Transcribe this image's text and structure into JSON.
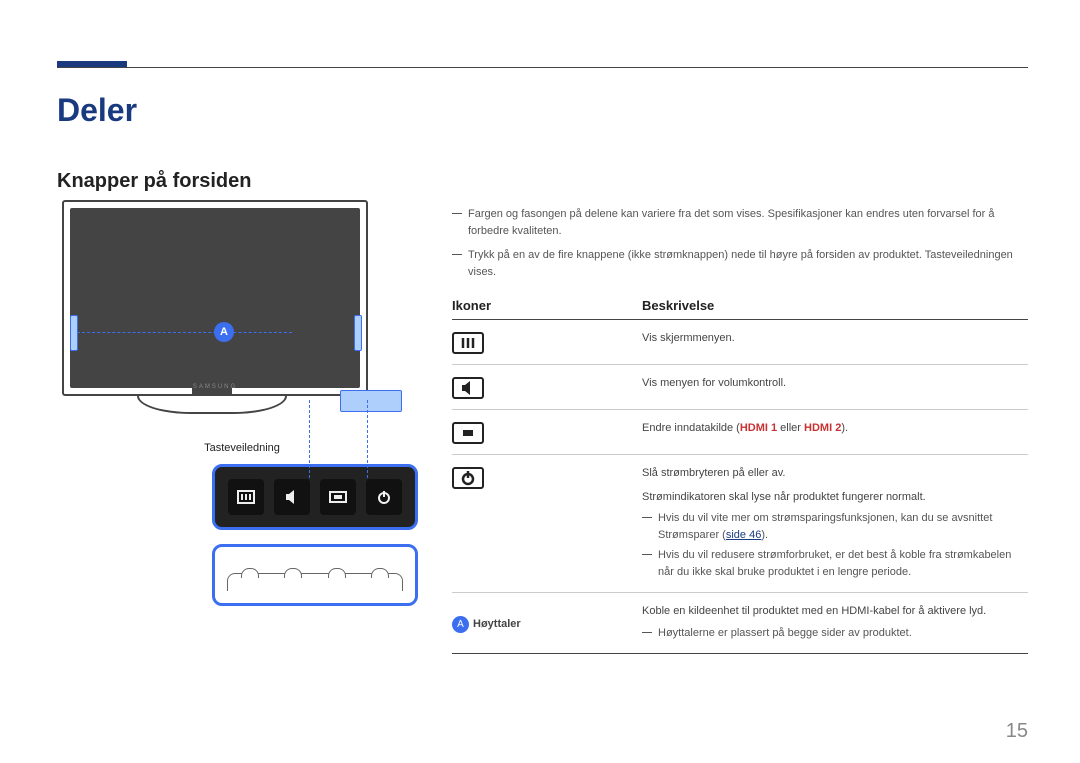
{
  "page_number": "15",
  "h1": "Deler",
  "h2": "Knapper på forsiden",
  "guide_label": "Tasteveiledning",
  "brand": "SAMSUNG",
  "marker_a": "A",
  "notes": {
    "n1": "Fargen og fasongen på delene kan variere fra det som vises. Spesifikasjoner kan endres uten forvarsel for å forbedre kvaliteten.",
    "n2": "Trykk på en av de fire knappene (ikke strømknappen) nede til høyre på forsiden av produktet. Tasteveiledningen vises."
  },
  "table": {
    "head_icon": "Ikoner",
    "head_desc": "Beskrivelse",
    "rows": [
      {
        "icon": "menu",
        "desc": "Vis skjermmenyen."
      },
      {
        "icon": "volume",
        "desc": "Vis menyen for volumkontroll."
      },
      {
        "icon": "source",
        "desc_pre": "Endre inndatakilde (",
        "hdmi1": "HDMI 1",
        "mid": " eller ",
        "hdmi2": "HDMI 2",
        "desc_post": ")."
      },
      {
        "icon": "power",
        "desc1": "Slå strømbryteren på eller av.",
        "desc2": "Strømindikatoren skal lyse når produktet fungerer normalt.",
        "note1_a": "Hvis du vil vite mer om strømsparingsfunksjonen, kan du se avsnittet Strømsparer (",
        "note1_link": "side 46",
        "note1_b": ").",
        "note2": "Hvis du vil redusere strømforbruket, er det best å koble fra strømkabelen når du ikke skal bruke produktet i en lengre periode."
      },
      {
        "icon": "speaker",
        "label": "Høyttaler",
        "desc1": "Koble en kildeenhet til produktet med en HDMI-kabel for å aktivere lyd.",
        "note1": "Høyttalerne er plassert på begge sider av produktet."
      }
    ]
  }
}
